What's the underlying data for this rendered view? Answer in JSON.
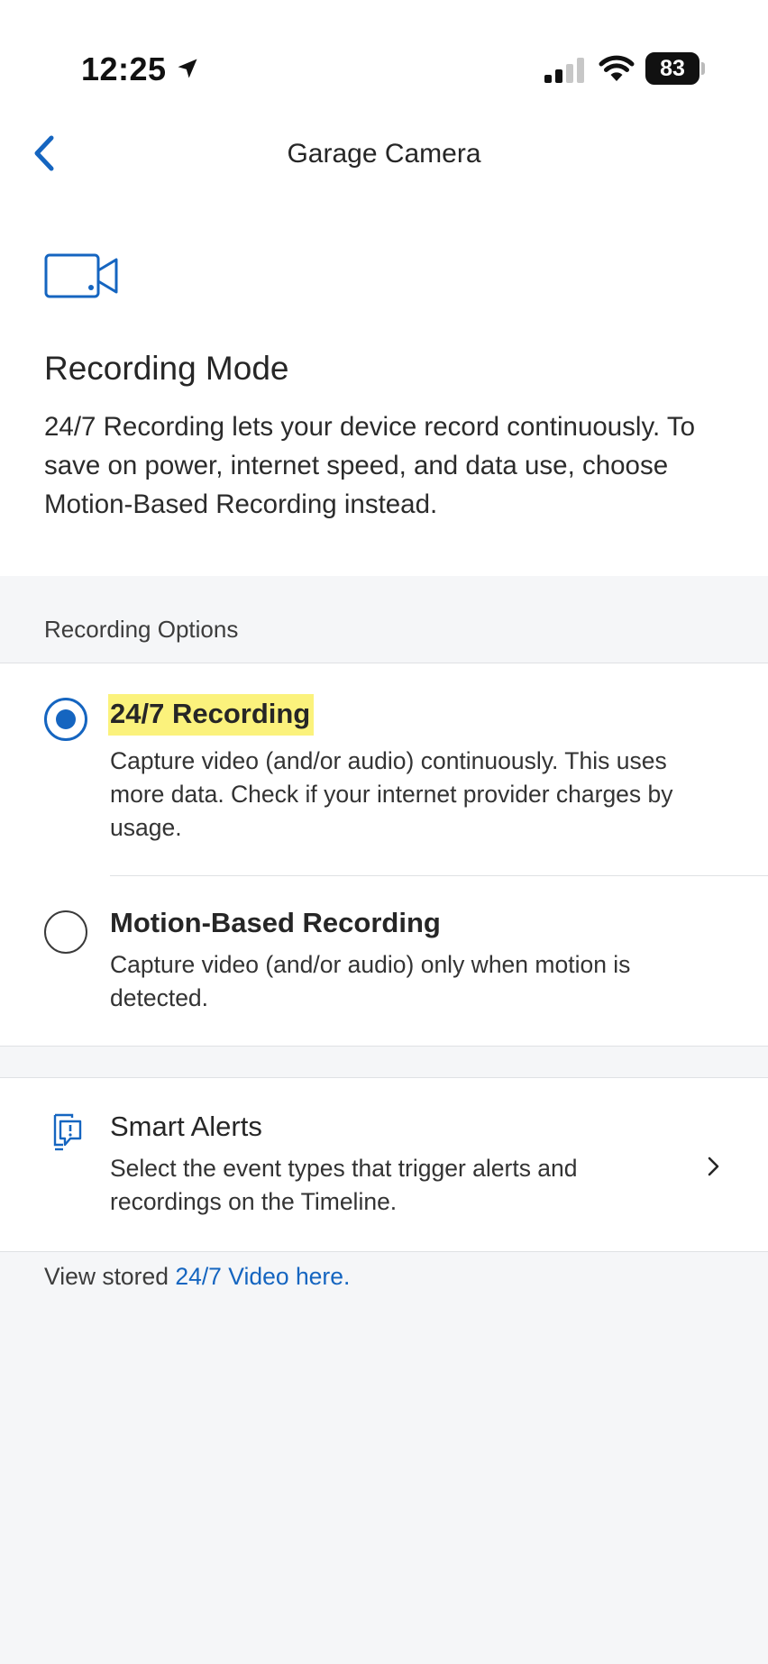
{
  "status_bar": {
    "time": "12:25",
    "battery": "83"
  },
  "nav": {
    "title": "Garage Camera"
  },
  "header": {
    "title": "Recording Mode",
    "description": "24/7 Recording lets your device record continuously. To save on power, internet speed, and data use, choose Motion-Based Recording instead."
  },
  "options": {
    "label": "Recording Options",
    "items": [
      {
        "title": "24/7 Recording",
        "description": "Capture video (and/or audio) continuously. This uses more data. Check if your internet provider charges by usage.",
        "selected": true
      },
      {
        "title": "Motion-Based Recording",
        "description": "Capture video (and/or audio) only when motion is detected.",
        "selected": false
      }
    ]
  },
  "smart_alerts": {
    "title": "Smart Alerts",
    "description": "Select the event types that trigger alerts and recordings on the Timeline."
  },
  "footer": {
    "prefix": "View stored ",
    "link": "24/7 Video here."
  },
  "colors": {
    "accent": "#1565c0",
    "highlight": "#fbf27c",
    "background": "#f5f6f8"
  },
  "icons": [
    "location-arrow-icon",
    "cellular-signal-icon",
    "wifi-icon",
    "battery-icon",
    "back-chevron-icon",
    "video-camera-icon",
    "smart-alerts-icon",
    "chevron-right-icon"
  ]
}
